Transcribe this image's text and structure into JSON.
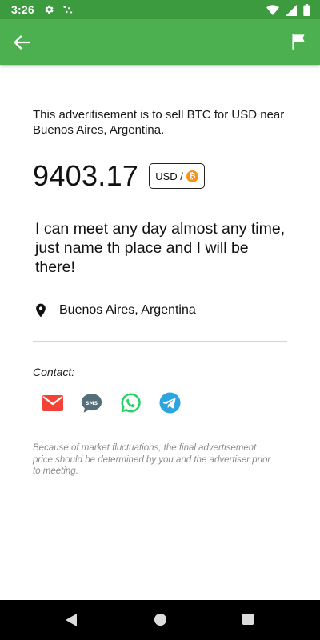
{
  "status_bar": {
    "time": "3:26",
    "left_icons": [
      "gear-icon",
      "dots-icon"
    ],
    "right_icons": [
      "wifi-icon",
      "signal-icon",
      "battery-icon"
    ]
  },
  "app_bar": {
    "back_icon": "arrow-left-icon",
    "flag_icon": "flag-icon",
    "color": "#4caf50"
  },
  "ad": {
    "description": "This adveritisement is to sell BTC for USD near Buenos Aires, Argentina.",
    "price": "9403.17",
    "currency_label": "USD /",
    "coin_symbol": "₿",
    "message": "I can meet any day almost any time, just name th place and I will be there!",
    "location": "Buenos Aires, Argentina"
  },
  "contact": {
    "label": "Contact:",
    "methods": [
      {
        "name": "email-icon",
        "color": "#f44336"
      },
      {
        "name": "sms-icon",
        "text": "SMS",
        "color": "#546e7a"
      },
      {
        "name": "whatsapp-icon",
        "color": "#25d366"
      },
      {
        "name": "telegram-icon",
        "color": "#2ca5e0"
      }
    ]
  },
  "disclaimer": "Because of market fluctuations, the final advertisement price should be determined by you and the advertiser prior to meeting.",
  "colors": {
    "status_bar": "#3c9a3f",
    "accent": "#4caf50",
    "bitcoin": "#f7931a"
  }
}
